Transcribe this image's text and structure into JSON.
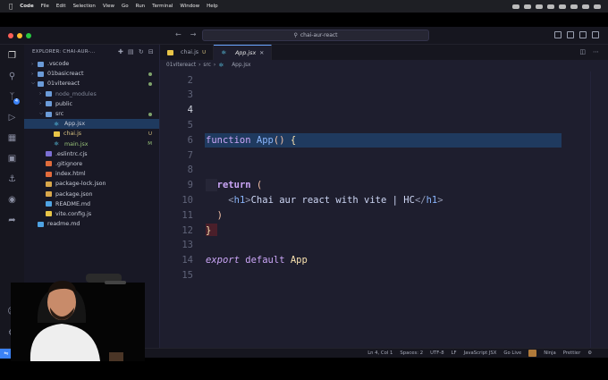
{
  "menubar": {
    "app": "Code",
    "items": [
      "File",
      "Edit",
      "Selection",
      "View",
      "Go",
      "Run",
      "Terminal",
      "Window",
      "Help"
    ]
  },
  "titlebar": {
    "search": "chai-aur-react"
  },
  "sidebar": {
    "header": "EXPLORER: CHAI-AUR-...",
    "tree": [
      {
        "label": ".vscode",
        "kind": "folder",
        "depth": 0,
        "open": false,
        "flag": ""
      },
      {
        "label": "01basicreact",
        "kind": "folder",
        "depth": 0,
        "open": false,
        "flag": "dot"
      },
      {
        "label": "01vitereact",
        "kind": "folder",
        "depth": 0,
        "open": true,
        "flag": "dot"
      },
      {
        "label": "node_modules",
        "kind": "folder",
        "depth": 1,
        "open": false,
        "flag": ""
      },
      {
        "label": "public",
        "kind": "folder",
        "depth": 1,
        "open": false,
        "flag": ""
      },
      {
        "label": "src",
        "kind": "folder",
        "depth": 1,
        "open": true,
        "flag": "dot"
      },
      {
        "label": "App.jsx",
        "kind": "react",
        "depth": 2,
        "open": false,
        "flag": ""
      },
      {
        "label": "chai.js",
        "kind": "js",
        "depth": 2,
        "open": false,
        "flag": "U"
      },
      {
        "label": "main.jsx",
        "kind": "react",
        "depth": 2,
        "open": false,
        "flag": "M"
      },
      {
        "label": ".eslintrc.cjs",
        "kind": "eslint",
        "depth": 1,
        "open": false,
        "flag": ""
      },
      {
        "label": ".gitignore",
        "kind": "git",
        "depth": 1,
        "open": false,
        "flag": ""
      },
      {
        "label": "index.html",
        "kind": "html",
        "depth": 1,
        "open": false,
        "flag": ""
      },
      {
        "label": "package-lock.json",
        "kind": "json",
        "depth": 1,
        "open": false,
        "flag": ""
      },
      {
        "label": "package.json",
        "kind": "json",
        "depth": 1,
        "open": false,
        "flag": ""
      },
      {
        "label": "README.md",
        "kind": "md",
        "depth": 1,
        "open": false,
        "flag": ""
      },
      {
        "label": "vite.config.js",
        "kind": "js",
        "depth": 1,
        "open": false,
        "flag": ""
      },
      {
        "label": "readme.md",
        "kind": "md",
        "depth": 0,
        "open": false,
        "flag": ""
      }
    ],
    "activity_badge": "4",
    "account_badge": "1"
  },
  "tabs": [
    {
      "label": "chai.js",
      "flag": "U",
      "active": false
    },
    {
      "label": "App.jsx",
      "flag": "",
      "active": true
    }
  ],
  "breadcrumb": [
    "01vitereact",
    "src",
    "App.jsx"
  ],
  "editor": {
    "lines": [
      {
        "n": "2",
        "code": ""
      },
      {
        "n": "3",
        "code": ""
      },
      {
        "n": "4",
        "code": ""
      },
      {
        "n": "5",
        "code": ""
      },
      {
        "n": "6",
        "code": "function App() {"
      },
      {
        "n": "7",
        "code": ""
      },
      {
        "n": "8",
        "code": ""
      },
      {
        "n": "9",
        "code": "  return ("
      },
      {
        "n": "10",
        "code": "    <h1>Chai aur react with vite | HC</h1>"
      },
      {
        "n": "11",
        "code": "  )"
      },
      {
        "n": "12",
        "code": "}"
      },
      {
        "n": "13",
        "code": ""
      },
      {
        "n": "14",
        "code": "export default App"
      },
      {
        "n": "15",
        "code": ""
      }
    ]
  },
  "statusbar": {
    "position": "Ln 4, Col 1",
    "spaces": "Spaces: 2",
    "encoding": "UTF-8",
    "eol": "LF",
    "language": "JavaScript JSX",
    "golive": "Go Live",
    "ninja": "Ninja",
    "prettier": "Prettier"
  },
  "colors": {
    "accent": "#3b82f6",
    "background": "#1e1e2e",
    "selection": "#1f3a5f"
  }
}
